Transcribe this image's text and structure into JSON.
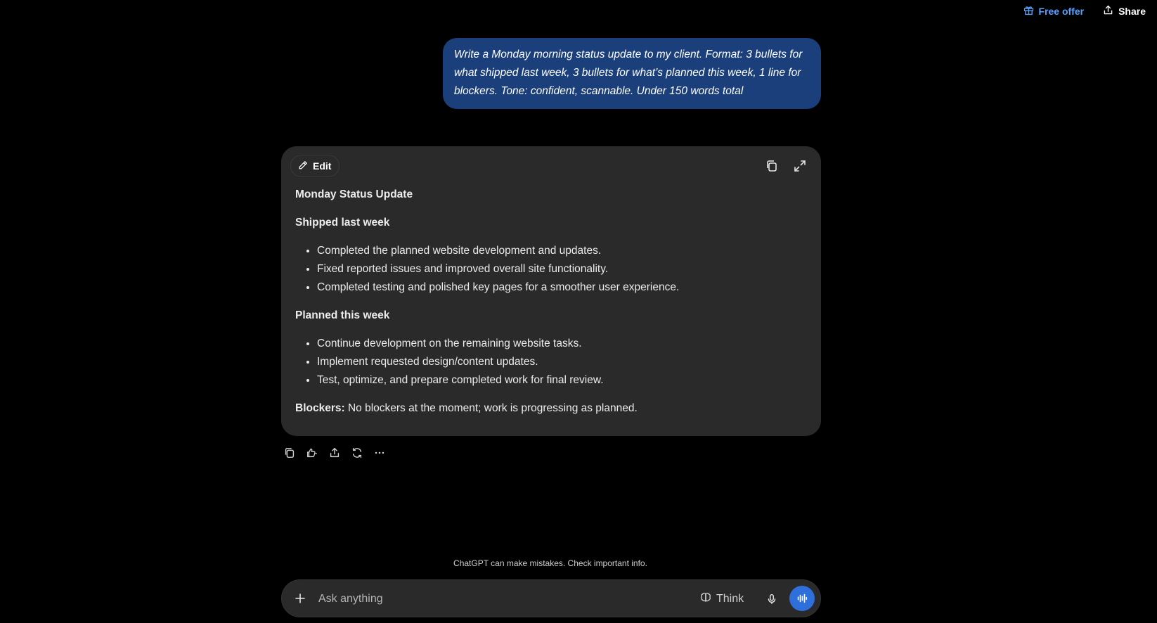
{
  "header": {
    "offer_label": "Free offer",
    "share_label": "Share"
  },
  "colors": {
    "accent": "#5aa0ff",
    "user_bubble": "#1a3f7a",
    "card_bg": "#2a2a2a",
    "voice_button": "#2f6fdb"
  },
  "user_message": {
    "text": "Write a Monday morning status update to my client. Format: 3 bullets for what shipped last week, 3 bullets for what’s planned this week, 1 line for blockers. Tone: confident, scannable. Under 150 words total"
  },
  "canvas": {
    "edit_label": "Edit",
    "icons": [
      "copy-icon",
      "expand-icon"
    ],
    "title": "Monday Status Update",
    "shipped_heading": "Shipped last week",
    "shipped": [
      "Completed the planned website development and updates.",
      "Fixed reported issues and improved overall site functionality.",
      "Completed testing and polished key pages for a smoother user experience."
    ],
    "planned_heading": "Planned this week",
    "planned": [
      "Continue development on the remaining website tasks.",
      "Implement requested design/content updates.",
      "Test, optimize, and prepare completed work for final review."
    ],
    "blockers_label": "Blockers:",
    "blockers_text": " No blockers at the moment; work is progressing as planned."
  },
  "message_actions": [
    "copy-icon",
    "thumbs-icon",
    "share-icon",
    "regenerate-icon",
    "more-icon"
  ],
  "footer": {
    "notice": "ChatGPT can make mistakes. Check important info."
  },
  "composer": {
    "placeholder": "Ask anything",
    "think_label": "Think"
  }
}
